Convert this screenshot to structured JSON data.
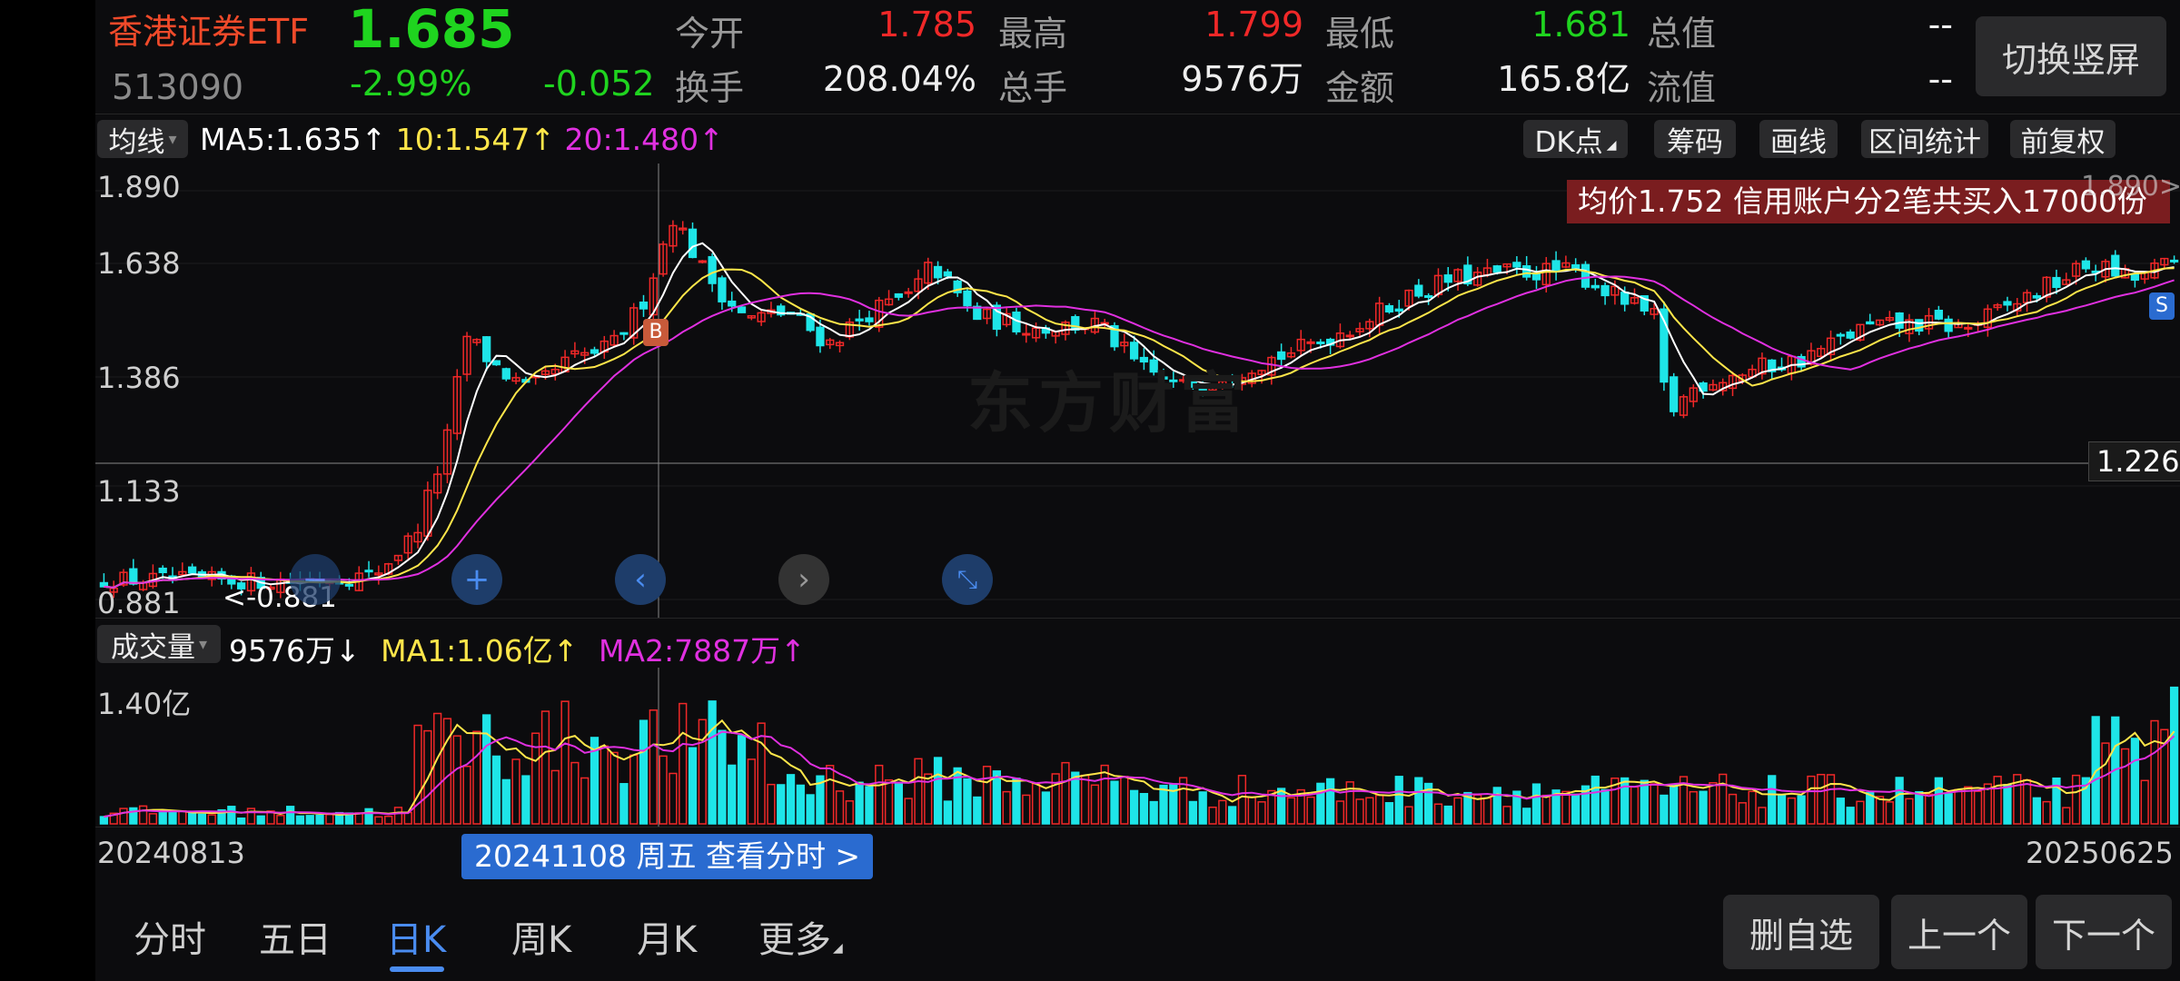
{
  "header": {
    "name": "香港证券ETF",
    "price": "1.685",
    "code": "513090",
    "change_pct": "-2.99%",
    "change": "-0.052",
    "stats": [
      {
        "label": "今开",
        "value": "1.785",
        "color": "red"
      },
      {
        "label": "最高",
        "value": "1.799",
        "color": "red"
      },
      {
        "label": "最低",
        "value": "1.681",
        "color": "green"
      },
      {
        "label": "总值",
        "value": "--",
        "color": "white"
      },
      {
        "label": "换手",
        "value": "208.04%",
        "color": "white"
      },
      {
        "label": "总手",
        "value": "9576万",
        "color": "white"
      },
      {
        "label": "金额",
        "value": "165.8亿",
        "color": "white"
      },
      {
        "label": "流值",
        "value": "--",
        "color": "white"
      }
    ],
    "orientation_button": "切换竖屏"
  },
  "ma_bar": {
    "selector": "均线",
    "ma5": "MA5:1.635",
    "ma10": "10:1.547",
    "ma20": "20:1.480",
    "arrow": "↑"
  },
  "tool_buttons": [
    "DK点",
    "筹码",
    "画线",
    "区间统计",
    "前复权"
  ],
  "price_axis": [
    "1.890",
    "1.638",
    "1.386",
    "1.133",
    "0.881"
  ],
  "crosshair_price": "1.226",
  "top_price_label": "1.890>",
  "min_marker": "<-0.881",
  "trade_banner": "均价1.752  信用账户分2笔共买入17000份",
  "watermark": "东方财富",
  "buy_marker": "B",
  "sell_marker": "S",
  "volume_bar": {
    "selector": "成交量",
    "vol": "9576万",
    "vol_arrow": "↓",
    "ma1": "MA1:1.06亿",
    "ma2": "MA2:7887万",
    "arrow": "↑"
  },
  "volume_axis": "1.40亿",
  "date_start": "20240813",
  "date_end": "20250625",
  "date_popup": "20241108 周五 查看分时 >",
  "nav_icons": [
    "zoom-out",
    "zoom-in",
    "prev",
    "next",
    "collapse"
  ],
  "tabs": [
    "分时",
    "五日",
    "日K",
    "周K",
    "月K",
    "更多"
  ],
  "active_tab": "日K",
  "bottom_buttons": [
    "删自选",
    "上一个",
    "下一个"
  ],
  "colors": {
    "up": "#f02828",
    "down": "#1ee5e8",
    "ma5": "#ffffff",
    "ma10": "#ffe64a",
    "ma20": "#e030e0",
    "accent": "#4a8cf0"
  },
  "chart_data": {
    "type": "candlestick",
    "x_start": "20240813",
    "x_end": "20250625",
    "ylim": [
      0.881,
      1.89
    ],
    "close_anchors": [
      {
        "t": 0.0,
        "v": 0.89
      },
      {
        "t": 0.08,
        "v": 0.886
      },
      {
        "t": 0.13,
        "v": 0.9
      },
      {
        "t": 0.15,
        "v": 1.0
      },
      {
        "t": 0.165,
        "v": 1.22
      },
      {
        "t": 0.175,
        "v": 1.5
      },
      {
        "t": 0.19,
        "v": 1.42
      },
      {
        "t": 0.205,
        "v": 1.36
      },
      {
        "t": 0.225,
        "v": 1.44
      },
      {
        "t": 0.245,
        "v": 1.47
      },
      {
        "t": 0.26,
        "v": 1.58
      },
      {
        "t": 0.275,
        "v": 1.8
      },
      {
        "t": 0.29,
        "v": 1.66
      },
      {
        "t": 0.31,
        "v": 1.54
      },
      {
        "t": 0.33,
        "v": 1.56
      },
      {
        "t": 0.35,
        "v": 1.48
      },
      {
        "t": 0.37,
        "v": 1.56
      },
      {
        "t": 0.39,
        "v": 1.6
      },
      {
        "t": 0.4,
        "v": 1.68
      },
      {
        "t": 0.42,
        "v": 1.55
      },
      {
        "t": 0.45,
        "v": 1.52
      },
      {
        "t": 0.48,
        "v": 1.53
      },
      {
        "t": 0.5,
        "v": 1.42
      },
      {
        "t": 0.52,
        "v": 1.37
      },
      {
        "t": 0.55,
        "v": 1.42
      },
      {
        "t": 0.58,
        "v": 1.47
      },
      {
        "t": 0.61,
        "v": 1.54
      },
      {
        "t": 0.63,
        "v": 1.6
      },
      {
        "t": 0.65,
        "v": 1.64
      },
      {
        "t": 0.68,
        "v": 1.66
      },
      {
        "t": 0.71,
        "v": 1.66
      },
      {
        "t": 0.73,
        "v": 1.6
      },
      {
        "t": 0.75,
        "v": 1.54
      },
      {
        "t": 0.755,
        "v": 1.3
      },
      {
        "t": 0.77,
        "v": 1.38
      },
      {
        "t": 0.8,
        "v": 1.42
      },
      {
        "t": 0.82,
        "v": 1.44
      },
      {
        "t": 0.85,
        "v": 1.52
      },
      {
        "t": 0.88,
        "v": 1.53
      },
      {
        "t": 0.9,
        "v": 1.52
      },
      {
        "t": 0.93,
        "v": 1.6
      },
      {
        "t": 0.96,
        "v": 1.68
      },
      {
        "t": 0.98,
        "v": 1.64
      },
      {
        "t": 1.0,
        "v": 1.685
      }
    ]
  }
}
